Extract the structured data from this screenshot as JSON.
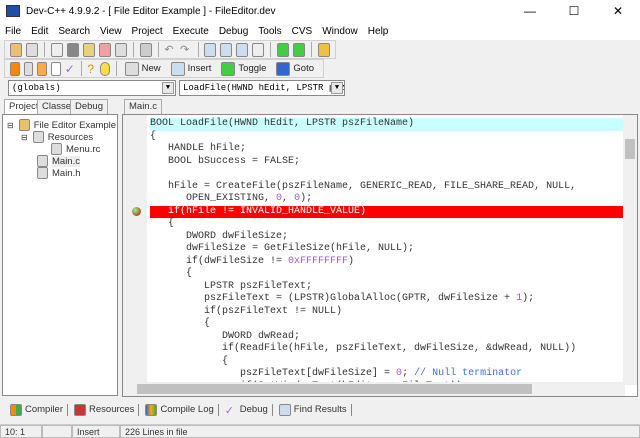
{
  "window": {
    "title": "Dev-C++ 4.9.9.2  -  [ File Editor Example ] - FileEditor.dev"
  },
  "menu": [
    "File",
    "Edit",
    "Search",
    "View",
    "Project",
    "Execute",
    "Debug",
    "Tools",
    "CVS",
    "Window",
    "Help"
  ],
  "toolbar2": {
    "new": "New",
    "insert": "Insert",
    "toggle": "Toggle",
    "goto": "Goto"
  },
  "combos": {
    "scope": "(globals)",
    "function": "LoadFile(HWND hEdit, LPSTR psz"
  },
  "left_tabs": [
    "Project",
    "Classes",
    "Debug"
  ],
  "editor_tab": "Main.c",
  "tree": {
    "root": "File Editor Example",
    "resources": "Resources",
    "menu_rc": "Menu.rc",
    "main_c": "Main.c",
    "main_h": "Main.h"
  },
  "code": [
    "BOOL LoadFile(HWND hEdit, LPSTR pszFileName)",
    "{",
    "   HANDLE hFile;",
    "   BOOL bSuccess = FALSE;",
    "",
    "   hFile = CreateFile(pszFileName, GENERIC_READ, FILE_SHARE_READ, NULL,",
    "      OPEN_EXISTING, 0, 0);",
    "   if(hFile != INVALID_HANDLE_VALUE)",
    "   {",
    "      DWORD dwFileSize;",
    "      dwFileSize = GetFileSize(hFile, NULL);",
    "      if(dwFileSize != 0xFFFFFFFF)",
    "      {",
    "         LPSTR pszFileText;",
    "         pszFileText = (LPSTR)GlobalAlloc(GPTR, dwFileSize + 1);",
    "         if(pszFileText != NULL)",
    "         {",
    "            DWORD dwRead;",
    "            if(ReadFile(hFile, pszFileText, dwFileSize, &dwRead, NULL))",
    "            {",
    "               pszFileText[dwFileSize] = 0; // Null terminator",
    "               if(SetWindowText(hEdit, pszFileText))"
  ],
  "bottom_tabs": [
    "Compiler",
    "Resources",
    "Compile Log",
    "Debug",
    "Find Results"
  ],
  "status": {
    "position": "10: 1",
    "modified": "",
    "mode": "Insert",
    "lines": "226 Lines in file"
  }
}
